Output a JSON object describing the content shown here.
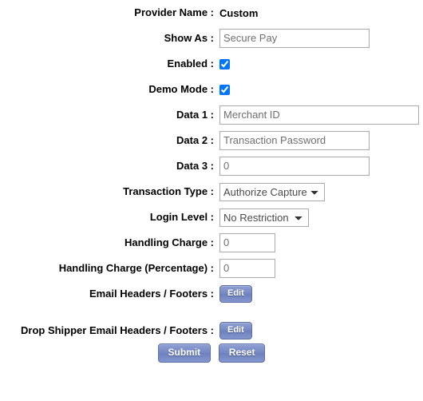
{
  "form": {
    "rows": [
      {
        "id": "provider-name",
        "label": "Provider Name :",
        "type": "static",
        "value": "Custom"
      },
      {
        "id": "show-as",
        "label": "Show As :",
        "type": "text",
        "value": "Secure Pay",
        "placeholder": "Secure Pay"
      },
      {
        "id": "enabled",
        "label": "Enabled :",
        "type": "checkbox",
        "checked": true
      },
      {
        "id": "demo-mode",
        "label": "Demo Mode :",
        "type": "checkbox",
        "checked": true
      },
      {
        "id": "data-1",
        "label": "Data 1 :",
        "type": "text",
        "value": "Merchant ID",
        "placeholder": "Merchant ID"
      },
      {
        "id": "data-2",
        "label": "Data 2 :",
        "type": "text",
        "value": "Transaction Password",
        "placeholder": "Transaction Password"
      },
      {
        "id": "data-3",
        "label": "Data 3 :",
        "type": "text",
        "value": "0",
        "placeholder": "0"
      },
      {
        "id": "transaction-type",
        "label": "Transaction Type :",
        "type": "select",
        "value": "Authorize Capture",
        "options": [
          "Authorize Capture"
        ]
      },
      {
        "id": "login-level",
        "label": "Login Level :",
        "type": "select",
        "value": "No Restriction",
        "options": [
          "No Restriction"
        ]
      },
      {
        "id": "handling-charge",
        "label": "Handling Charge :",
        "type": "text",
        "value": "0",
        "placeholder": "0"
      },
      {
        "id": "handling-charge-percentage",
        "label": "Handling Charge (Percentage) :",
        "type": "text",
        "value": "0",
        "placeholder": "0"
      },
      {
        "id": "email-headers-footers",
        "label": "Email Headers / Footers :",
        "type": "button",
        "button_label": "Edit"
      },
      {
        "id": "drop-shipper-email-headers-footers",
        "label": "Drop Shipper Email Headers / Footers :",
        "type": "button",
        "button_label": "Edit"
      }
    ],
    "actions": {
      "submit_label": "Submit",
      "reset_label": "Reset"
    }
  },
  "colors": {
    "button_face": "#7487c2",
    "button_border": "#5d6fa8",
    "input_border": "#a9a9a9",
    "placeholder_text": "#6f6f6f",
    "label_text": "#000000",
    "page_background": "#ffffff"
  }
}
